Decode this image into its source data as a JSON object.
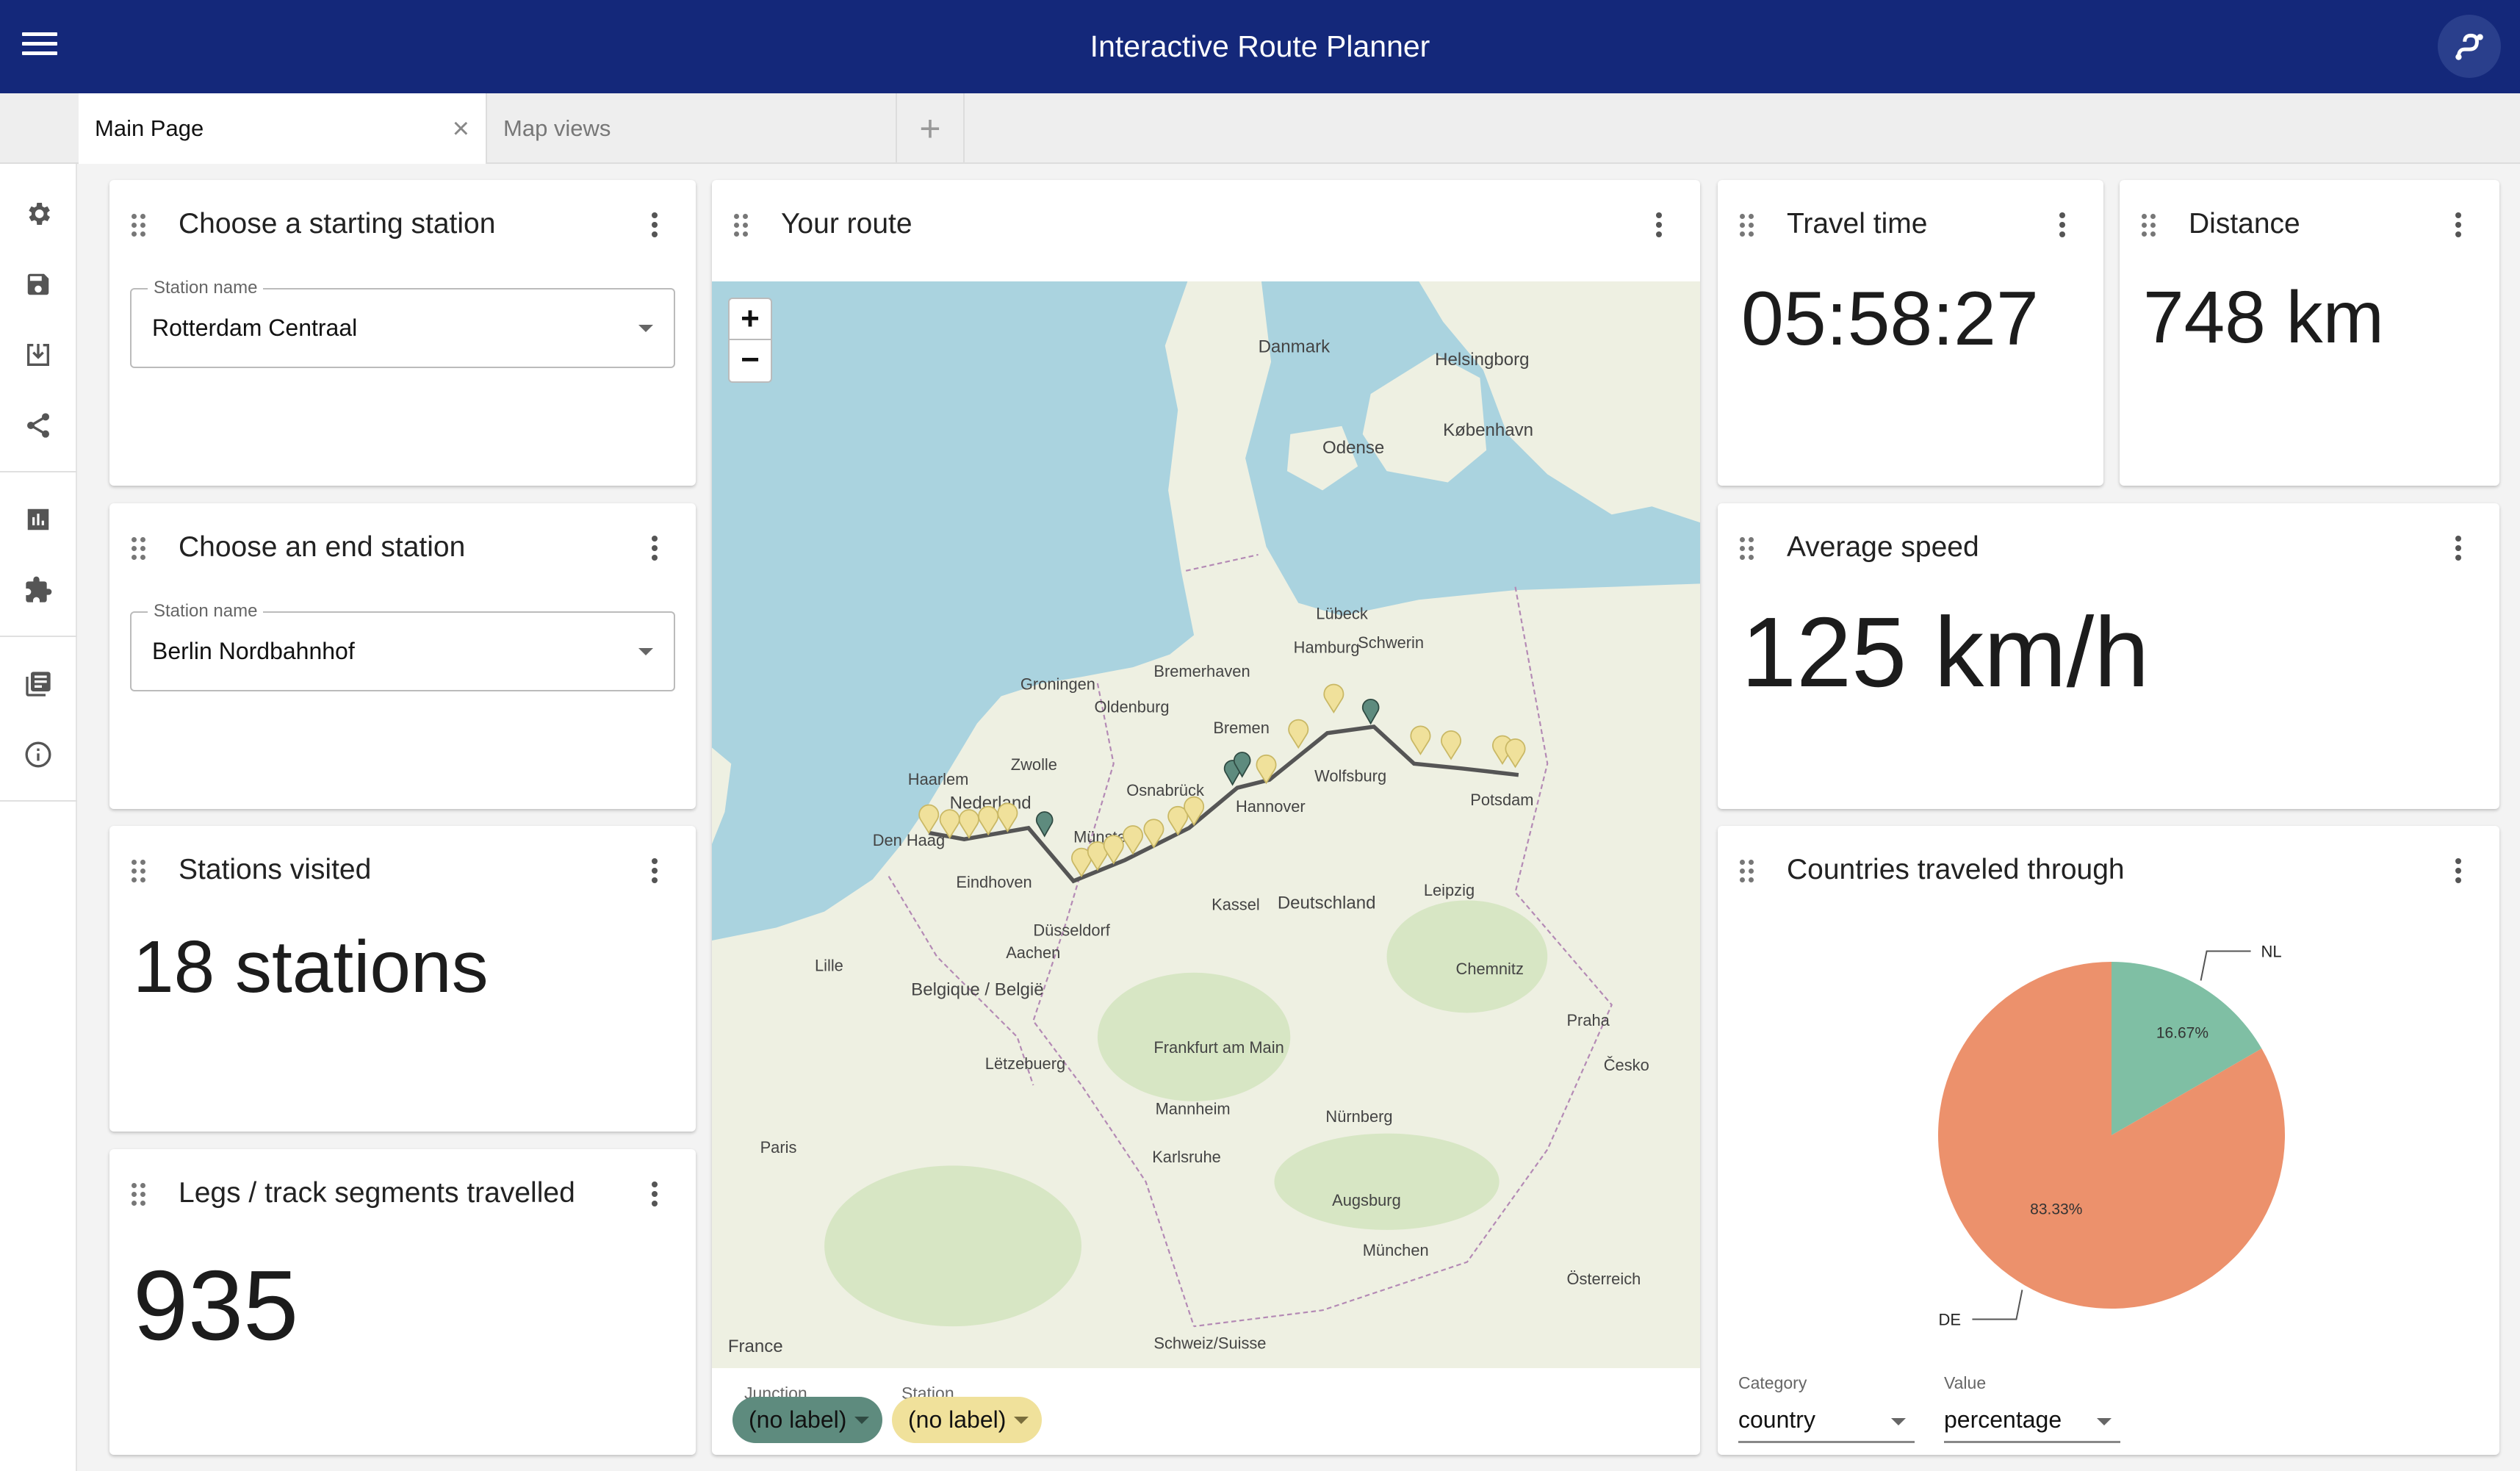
{
  "header": {
    "title": "Interactive Route Planner",
    "menu_icon": "hamburger-menu-icon",
    "avatar_icon": "route-icon",
    "color": "#14287a"
  },
  "tabs": [
    {
      "label": "Main Page",
      "active": true
    },
    {
      "label": "Map views",
      "active": false
    }
  ],
  "tab_add": "+",
  "tab_close": "×",
  "sidebar": {
    "items": [
      "settings",
      "save",
      "import",
      "share",
      "charts",
      "extensions",
      "documentation",
      "info"
    ]
  },
  "cards": {
    "start": {
      "title": "Choose a starting station",
      "field_label": "Station name",
      "value": "Rotterdam Centraal"
    },
    "end": {
      "title": "Choose an end station",
      "field_label": "Station name",
      "value": "Berlin Nordbahnhof"
    },
    "stations": {
      "title": "Stations visited",
      "value": "18 stations"
    },
    "legs": {
      "title": "Legs / track segments travelled",
      "value": "935"
    },
    "route": {
      "title": "Your route",
      "zoom_in": "+",
      "zoom_out": "−",
      "legend": [
        {
          "label": "Junction",
          "value": "(no label)",
          "color": "#5e8b7e"
        },
        {
          "label": "Station",
          "value": "(no label)",
          "color": "#f0e19b"
        }
      ],
      "map_labels": [
        "Danmark",
        "København",
        "Helsingborg",
        "Odense",
        "Hamburg",
        "Bremen",
        "Bremerhaven",
        "Hannover",
        "Groningen",
        "Nederland",
        "Haarlem",
        "Den Haag",
        "Osnabrück",
        "Münster",
        "Wolfsburg",
        "Potsdam",
        "Lübeck",
        "Schwerin",
        "Deutschland",
        "Leipzig",
        "Kassel",
        "Düsseldorf",
        "Eindhoven",
        "Lille",
        "Belgique / België",
        "Frankfurt am Main",
        "Nürnberg",
        "München",
        "Praha",
        "Paris",
        "Lëtzebuerg",
        "Karlsruhe",
        "Mannheim",
        "Schweiz/Suisse",
        "France",
        "Chemnitz",
        "Augsburg",
        "Česko",
        "Österreich",
        "Zwolle",
        "Oldenburg",
        "Aachen"
      ]
    },
    "travel_time": {
      "title": "Travel time",
      "value": "05:58:27"
    },
    "distance": {
      "title": "Distance",
      "value": "748 km"
    },
    "speed": {
      "title": "Average speed",
      "value": "125 km/h"
    },
    "countries": {
      "title": "Countries traveled through",
      "category_label": "Category",
      "category_value": "country",
      "value_label": "Value",
      "value_value": "percentage"
    }
  },
  "chart_data": {
    "type": "pie",
    "categories": [
      "NL",
      "DE"
    ],
    "values": [
      16.67,
      83.33
    ],
    "data_labels": [
      "16.67%",
      "83.33%"
    ],
    "colors": [
      "#7fbfa4",
      "#ec916c"
    ],
    "start": "12 o'clock",
    "direction": "clockwise"
  }
}
